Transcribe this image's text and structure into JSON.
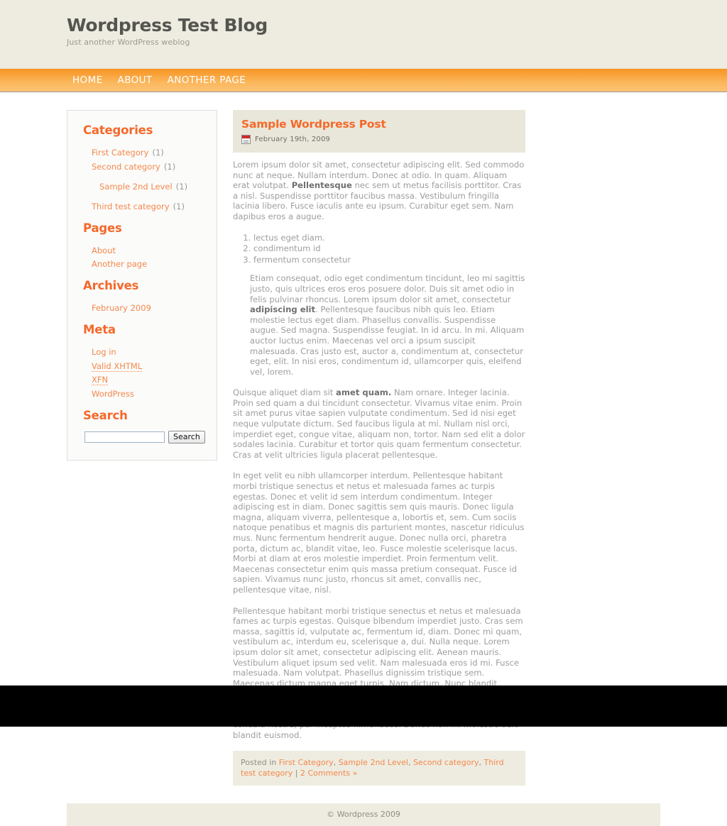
{
  "header": {
    "title": "Wordpress Test Blog",
    "tagline": "Just another WordPress weblog"
  },
  "nav": {
    "items": [
      {
        "label": "HOME"
      },
      {
        "label": "ABOUT"
      },
      {
        "label": "ANOTHER PAGE"
      }
    ]
  },
  "sidebar": {
    "categories": {
      "title": "Categories",
      "items": [
        {
          "label": "First Category",
          "count": "(1)",
          "sub": false
        },
        {
          "label": "Second category",
          "count": "(1)",
          "sub": false
        },
        {
          "label": "Sample 2nd Level",
          "count": "(1)",
          "sub": true
        },
        {
          "label": "Third test category",
          "count": "(1)",
          "sub": false
        }
      ]
    },
    "pages": {
      "title": "Pages",
      "items": [
        {
          "label": "About"
        },
        {
          "label": "Another page"
        }
      ]
    },
    "archives": {
      "title": "Archives",
      "items": [
        {
          "label": "February 2009"
        }
      ]
    },
    "meta": {
      "title": "Meta",
      "items": [
        {
          "label": "Log in",
          "dotted": false
        },
        {
          "label": "Valid XHTML",
          "dotted": true
        },
        {
          "label": "XFN",
          "dotted": true
        },
        {
          "label": "WordPress",
          "dotted": false
        }
      ]
    },
    "search": {
      "title": "Search",
      "value": "",
      "placeholder": "",
      "button_label": "Search"
    }
  },
  "post": {
    "title": "Sample Wordpress Post",
    "date": "February 19th, 2009",
    "date_icon": "calendar-icon",
    "paragraph_1_a": "Lorem ipsum dolor sit amet, consectetur adipiscing elit. Sed commodo nunc at neque. Nullam interdum. Donec at odio. In quam. Aliquam erat volutpat. ",
    "paragraph_1_bold": "Pellentesque",
    "paragraph_1_b": " nec sem ut metus facilisis porttitor. Cras a nisl. Suspendisse porttitor faucibus massa. Vestibulum fringilla lacinia libero. Fusce iaculis ante eu ipsum. Curabitur eget sem. Nam dapibus eros a augue.",
    "list": [
      "lectus eget diam.",
      "condimentum id",
      "fermentum consectetur"
    ],
    "quote_a": "Etiam consequat, odio eget condimentum tincidunt, leo mi sagittis justo, quis ultrices eros eros posuere dolor. Duis sit amet odio in felis pulvinar rhoncus. Lorem ipsum dolor sit amet, consectetur ",
    "quote_bold": "adipiscing elit",
    "quote_b": ". Pellentesque faucibus nibh quis leo. Etiam molestie lectus eget diam. Phasellus convallis. Suspendisse augue. Sed magna. Suspendisse feugiat. In id arcu. In mi. Aliquam auctor luctus enim. Maecenas vel orci a ipsum suscipit malesuada. Cras justo est, auctor a, condimentum at, consectetur eget, elit. In nisi eros, condimentum id, ullamcorper quis, eleifend vel, lorem.",
    "paragraph_2_a": "Quisque aliquet diam sit ",
    "paragraph_2_bold": "amet quam.",
    "paragraph_2_b": " Nam ornare. Integer lacinia. Proin sed quam a dui tincidunt consectetur. Vivamus vitae enim. Proin sit amet purus vitae sapien vulputate condimentum. Sed id nisi eget neque vulputate dictum. Sed faucibus ligula at mi. Nullam nisl orci, imperdiet eget, congue vitae, aliquam non, tortor. Nam sed elit a dolor sodales lacinia. Curabitur et tortor quis quam fermentum consectetur. Cras at velit ultricies ligula placerat pellentesque.",
    "paragraph_3": "In eget velit eu nibh ullamcorper interdum. Pellentesque habitant morbi tristique senectus et netus et malesuada fames ac turpis egestas. Donec et velit id sem interdum condimentum. Integer adipiscing est in diam. Donec sagittis sem quis mauris. Donec ligula magna, aliquam viverra, pellentesque a, lobortis et, sem. Cum sociis natoque penatibus et magnis dis parturient montes, nascetur ridiculus mus. Nunc fermentum hendrerit augue. Donec nulla orci, pharetra porta, dictum ac, blandit vitae, leo. Fusce molestie scelerisque lacus. Morbi at diam at eros molestie imperdiet. Proin fermentum velit. Maecenas consectetur enim quis massa pretium consequat. Fusce id sapien. Vivamus nunc justo, rhoncus sit amet, convallis nec, pellentesque vitae, nisl.",
    "paragraph_4": "Pellentesque habitant morbi tristique senectus et netus et malesuada fames ac turpis egestas. Quisque bibendum imperdiet justo. Cras sem massa, sagittis id, vulputate ac, fermentum id, diam. Donec mi quam, vestibulum ac, interdum eu, scelerisque a, dui. Nulla neque. Lorem ipsum dolor sit amet, consectetur adipiscing elit. Aenean mauris. Vestibulum aliquet ipsum sed velit. Nam malesuada eros id mi. Fusce malesuada. Nam volutpat. Phasellus dignissim tristique sem. Maecenas dictum magna eget turpis. Nam dictum. Nunc blandit turpis. Maecenas risus massa, lobortis eget, vulputate auctor, tincidunt a, metus. Praesent volutpat eros eget mauris. Nam lacinia purus a sapien. Class aptent taciti sociosqu ad litora torquent per conubia nostra, per inceptos himenaeos. Donec non mi molestie odio blandit euismod.",
    "meta": {
      "posted_in_label": "Posted in ",
      "categories": [
        "First Category",
        "Sample 2nd Level",
        "Second category",
        "Third test category"
      ],
      "separator": " | ",
      "comments_label": "2 Comments »"
    }
  },
  "footer": {
    "copyright": "© Wordpress 2009"
  },
  "colors": {
    "accent": "#f4692a",
    "link": "#f4884c",
    "nav_top": "#f79522",
    "nav_bottom": "#fcc273",
    "header_bg": "#eeece0",
    "body_text": "#9e9e9e"
  }
}
